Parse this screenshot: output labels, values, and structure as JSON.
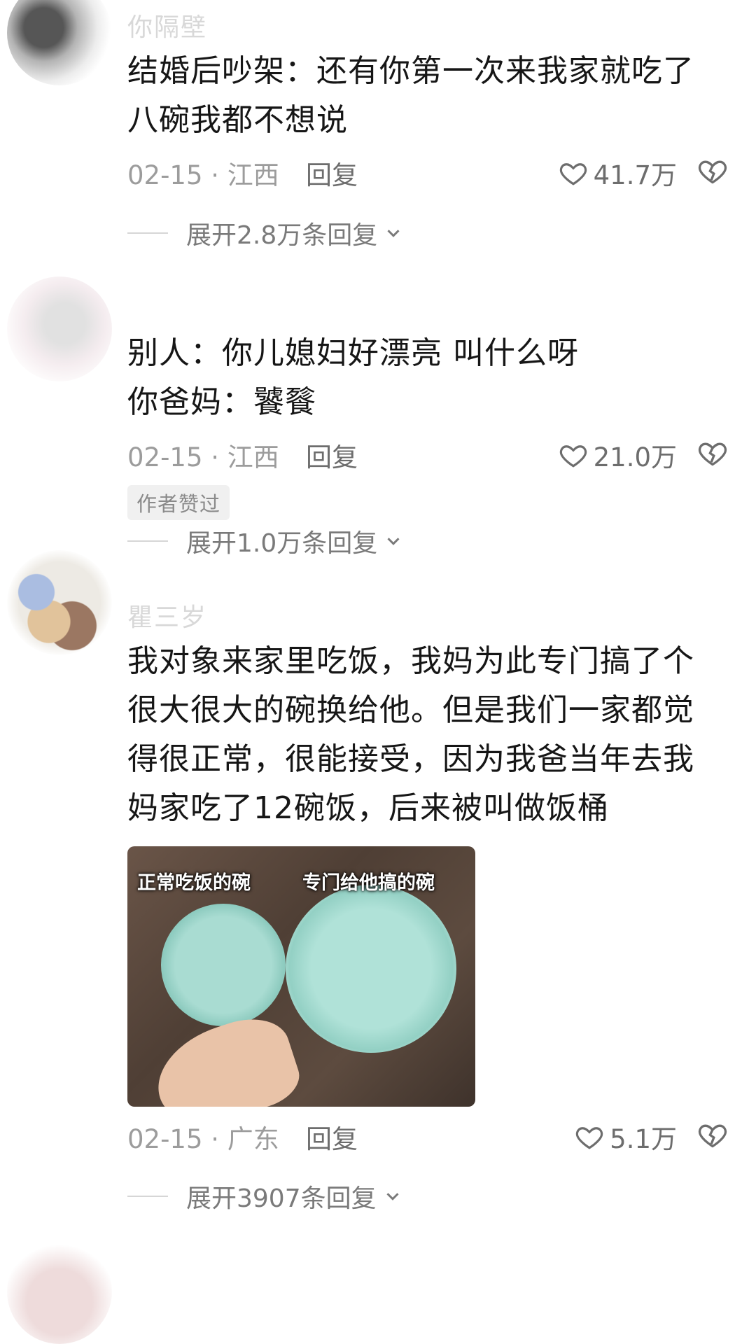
{
  "comments": [
    {
      "username": "你隔壁",
      "text": "结婚后吵架：还有你第一次来我家就吃了八碗我都不想说",
      "date_location": "02-15 · 江西",
      "reply_label": "回复",
      "likes": "41.7万",
      "expand_label": "展开2.8万条回复"
    },
    {
      "username": "",
      "text_line1": "别人：你儿媳妇好漂亮 叫什么呀",
      "text_line2": "你爸妈：饕餮",
      "date_location": "02-15 · 江西",
      "reply_label": "回复",
      "likes": "21.0万",
      "badge": "作者赞过",
      "expand_label": "展开1.0万条回复"
    },
    {
      "username": "瞿三岁",
      "text": "我对象来家里吃饭，我妈为此专门搞了个很大很大的碗换给他。但是我们一家都觉得很正常，很能接受，因为我爸当年去我妈家吃了12碗饭，后来被叫做饭桶",
      "image": {
        "label_left": "正常吃饭的碗",
        "label_right": "专门给他搞的碗"
      },
      "date_location": "02-15 · 广东",
      "reply_label": "回复",
      "likes": "5.1万",
      "expand_label": "展开3907条回复"
    }
  ],
  "icons": {
    "like": "heart-icon",
    "dislike": "broken-heart-icon",
    "expand": "chevron-down-icon"
  },
  "colors": {
    "text": "#161616",
    "meta": "#9c9c9c",
    "badge_bg": "#f0f0f0"
  }
}
